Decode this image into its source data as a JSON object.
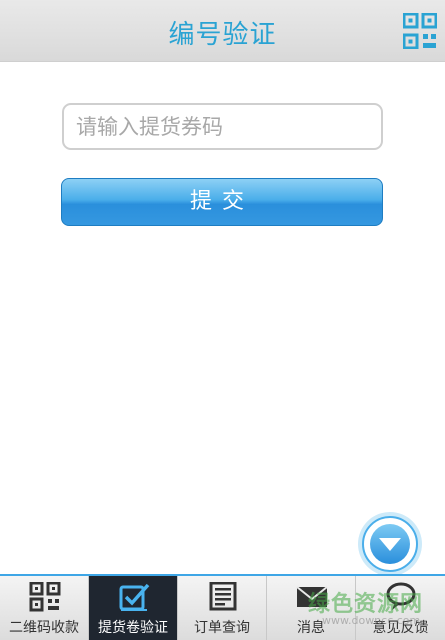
{
  "header": {
    "title": "编号验证",
    "qr_icon": "qr-code-icon"
  },
  "form": {
    "code_placeholder": "请输入提货券码",
    "code_value": "",
    "submit_label": "提交"
  },
  "fab": {
    "icon": "chevron-down-icon"
  },
  "tabbar": {
    "tabs": [
      {
        "label": "二维码收款",
        "icon": "qr-code-icon",
        "active": false
      },
      {
        "label": "提货卷验证",
        "icon": "checkbox-icon",
        "active": true
      },
      {
        "label": "订单查询",
        "icon": "document-list-icon",
        "active": false
      },
      {
        "label": "消息",
        "icon": "envelope-icon",
        "active": false
      },
      {
        "label": "意见反馈",
        "icon": "chat-bubble-icon",
        "active": false
      }
    ]
  },
  "watermark": {
    "text": "绿色资源网",
    "url": "www.downcc.com"
  },
  "colors": {
    "accent": "#2aa3d3",
    "button": "#3598e0",
    "active_tab": "#1f2630"
  }
}
